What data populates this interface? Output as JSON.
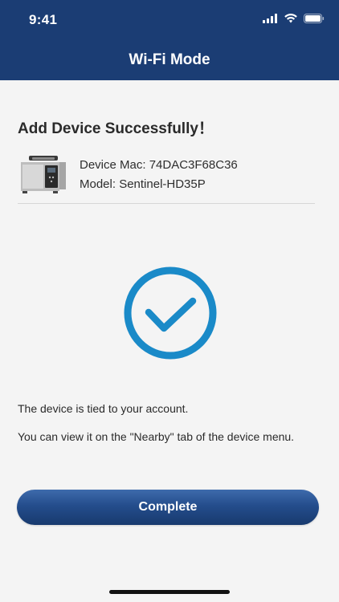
{
  "status_bar": {
    "time": "9:41",
    "icons": [
      "signal-icon",
      "wifi-icon",
      "battery-icon"
    ]
  },
  "header": {
    "title": "Wi-Fi Mode",
    "background_color": "#1b3d74"
  },
  "main": {
    "success_title": "Add Device Successfully！",
    "device": {
      "mac_line": "Device Mac: 74DAC3F68C36",
      "model_line": "Model: Sentinel-HD35P",
      "image_icon": "device-unit-image"
    },
    "check_icon": "check-circle-icon",
    "check_color": "#1a8ac8",
    "message_line1": "The device is tied to your account.",
    "message_line2": "You can view it on the \"Nearby\" tab of the device menu."
  },
  "footer": {
    "complete_label": "Complete",
    "button_color": "#244d8c"
  }
}
